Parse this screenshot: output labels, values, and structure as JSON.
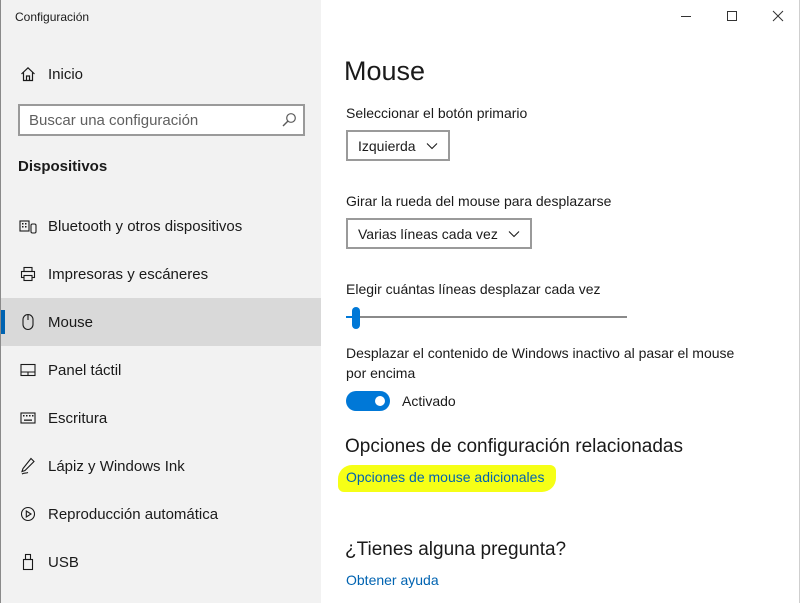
{
  "window": {
    "title": "Configuración",
    "controls": [
      "minimize",
      "maximize",
      "close"
    ]
  },
  "sidebar": {
    "home": {
      "label": "Inicio",
      "icon": "home-icon"
    },
    "search": {
      "placeholder": "Buscar una configuración",
      "value": "",
      "icon": "search-icon"
    },
    "section_title": "Dispositivos",
    "items": [
      {
        "label": "Bluetooth y otros dispositivos",
        "icon": "bluetooth-keyboard-icon",
        "selected": false
      },
      {
        "label": "Impresoras y escáneres",
        "icon": "printer-icon",
        "selected": false
      },
      {
        "label": "Mouse",
        "icon": "mouse-icon",
        "selected": true
      },
      {
        "label": "Panel táctil",
        "icon": "touchpad-icon",
        "selected": false
      },
      {
        "label": "Escritura",
        "icon": "keyboard-icon",
        "selected": false
      },
      {
        "label": "Lápiz y Windows Ink",
        "icon": "pen-icon",
        "selected": false
      },
      {
        "label": "Reproducción automática",
        "icon": "autoplay-icon",
        "selected": false
      },
      {
        "label": "USB",
        "icon": "usb-icon",
        "selected": false
      }
    ]
  },
  "main": {
    "title": "Mouse",
    "primary_button": {
      "label": "Seleccionar el botón primario",
      "selected": "Izquierda"
    },
    "wheel_scroll": {
      "label": "Girar la rueda del mouse para desplazarse",
      "selected": "Varias líneas cada vez"
    },
    "lines_to_scroll": {
      "label": "Elegir cuántas líneas desplazar cada vez",
      "min": 1,
      "max": 100,
      "value": 3
    },
    "inactive_scroll": {
      "label_line1": "Desplazar el contenido de Windows inactivo al pasar el mouse",
      "label_line2": "por encima",
      "on": true,
      "state_label": "Activado"
    },
    "related": {
      "heading": "Opciones de configuración relacionadas",
      "link": "Opciones de mouse adicionales",
      "highlight_color": "#f6ff16"
    },
    "question": {
      "heading": "¿Tienes alguna pregunta?",
      "link": "Obtener ayuda"
    }
  },
  "colors": {
    "accent": "#0078d7",
    "link": "#0063b1",
    "sidebar_bg": "#f2f2f2",
    "selected_bg": "#d9d9d9"
  }
}
